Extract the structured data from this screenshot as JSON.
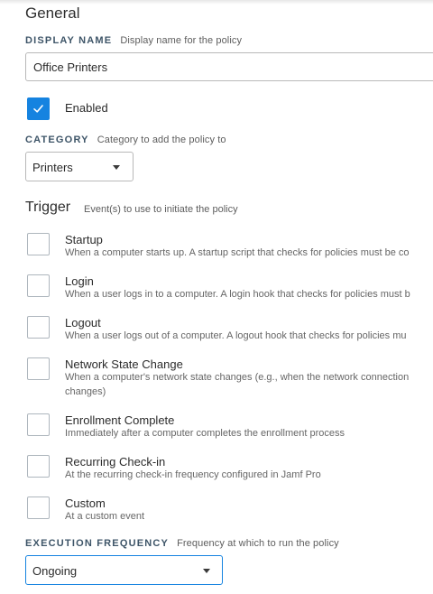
{
  "general": {
    "title": "General",
    "display_name": {
      "label": "DISPLAY NAME",
      "description": "Display name for the policy",
      "value": "Office Printers"
    },
    "enabled": {
      "label": "Enabled",
      "checked": true
    },
    "category": {
      "label": "CATEGORY",
      "description": "Category to add the policy to",
      "value": "Printers"
    }
  },
  "trigger": {
    "title": "Trigger",
    "description": "Event(s) to use to initiate the policy",
    "options": [
      {
        "title": "Startup",
        "description": "When a computer starts up. A startup script that checks for policies must be co",
        "checked": false
      },
      {
        "title": "Login",
        "description": "When a user logs in to a computer. A login hook that checks for policies must b",
        "checked": false
      },
      {
        "title": "Logout",
        "description": "When a user logs out of a computer. A logout hook that checks for policies mu",
        "checked": false
      },
      {
        "title": "Network State Change",
        "description": "When a computer's network state changes (e.g., when the network connection",
        "description_line2": "changes)",
        "checked": false
      },
      {
        "title": "Enrollment Complete",
        "description": "Immediately after a computer completes the enrollment process",
        "checked": false
      },
      {
        "title": "Recurring Check-in",
        "description": "At the recurring check-in frequency configured in Jamf Pro",
        "checked": false
      },
      {
        "title": "Custom",
        "description": "At a custom event",
        "checked": false
      }
    ]
  },
  "execution_frequency": {
    "label": "EXECUTION FREQUENCY",
    "description": "Frequency at which to run the policy",
    "value": "Ongoing"
  },
  "colors": {
    "accent": "#1583e0",
    "label": "#3e5568"
  }
}
